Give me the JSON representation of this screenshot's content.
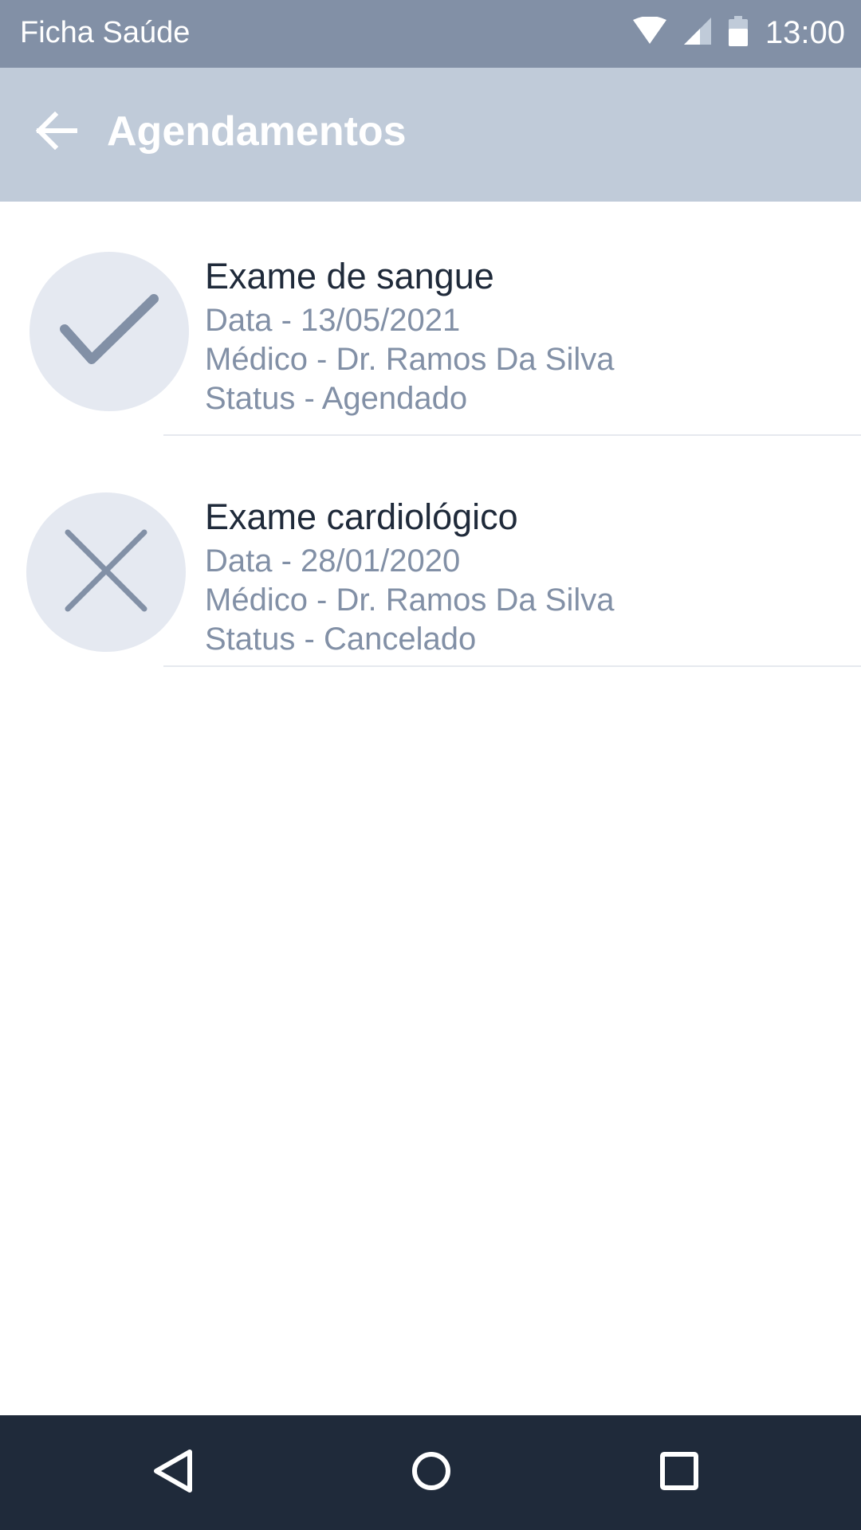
{
  "status_bar": {
    "app_name": "Ficha Saúde",
    "time": "13:00",
    "icons": [
      "wifi-icon",
      "cell-signal-icon",
      "battery-icon"
    ]
  },
  "app_bar": {
    "back_icon": "arrow-left-icon",
    "title": "Agendamentos"
  },
  "appointments": [
    {
      "status_icon": "check-icon",
      "title": "Exame de sangue",
      "date": "Data - 13/05/2021",
      "doctor": "Médico - Dr. Ramos Da Silva",
      "status": "Status - Agendado"
    },
    {
      "status_icon": "close-icon",
      "title": "Exame cardiológico",
      "date": "Data - 28/01/2020",
      "doctor": "Médico - Dr. Ramos Da Silva",
      "status": "Status - Cancelado"
    }
  ],
  "nav_bar": {
    "icons": [
      "nav-back-icon",
      "nav-home-icon",
      "nav-recents-icon"
    ]
  },
  "colors": {
    "status_bar_bg": "#8290a6",
    "app_bar_bg": "#c0cbd9",
    "avatar_bg": "#e5e9f1",
    "icon_gray": "#8290a6",
    "title_text": "#1f2a3a",
    "secondary_text": "#8290a6",
    "nav_bar_bg": "#1f2a3a"
  }
}
